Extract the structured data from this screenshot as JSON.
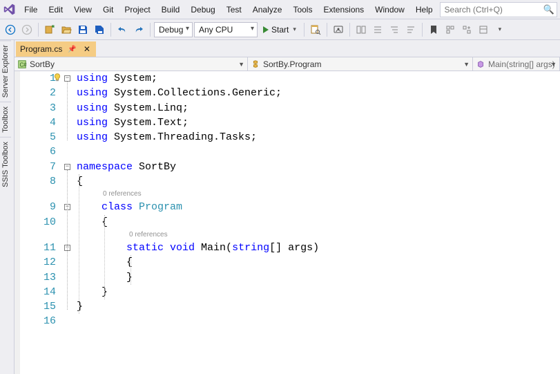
{
  "menu": [
    "File",
    "Edit",
    "View",
    "Git",
    "Project",
    "Build",
    "Debug",
    "Test",
    "Analyze",
    "Tools",
    "Extensions",
    "Window",
    "Help"
  ],
  "search": {
    "placeholder": "Search (Ctrl+Q)"
  },
  "toolbar": {
    "config": "Debug",
    "platform": "Any CPU",
    "start": "Start"
  },
  "sidetabs": [
    "Server Explorer",
    "Toolbox",
    "SSIS Toolbox"
  ],
  "doctab": {
    "title": "Program.cs"
  },
  "nav": {
    "project": "SortBy",
    "class": "SortBy.Program",
    "member": "Main(string[] args)"
  },
  "code": {
    "line_count": 16,
    "codelens": "0 references",
    "lines": [
      [
        {
          "t": "using ",
          "c": "kw"
        },
        {
          "t": "System;",
          "c": "plain"
        }
      ],
      [
        {
          "t": "using ",
          "c": "kw"
        },
        {
          "t": "System.Collections.Generic;",
          "c": "plain"
        }
      ],
      [
        {
          "t": "using ",
          "c": "kw"
        },
        {
          "t": "System.Linq;",
          "c": "plain"
        }
      ],
      [
        {
          "t": "using ",
          "c": "kw"
        },
        {
          "t": "System.Text;",
          "c": "plain"
        }
      ],
      [
        {
          "t": "using ",
          "c": "kw"
        },
        {
          "t": "System.Threading.Tasks;",
          "c": "plain"
        }
      ],
      [
        {
          "t": "",
          "c": "plain"
        }
      ],
      [
        {
          "t": "namespace ",
          "c": "kw"
        },
        {
          "t": "SortBy",
          "c": "plain"
        }
      ],
      [
        {
          "t": "{",
          "c": "plain"
        }
      ],
      [
        {
          "t": "    ",
          "c": "plain"
        },
        {
          "t": "class ",
          "c": "kw"
        },
        {
          "t": "Program",
          "c": "type"
        }
      ],
      [
        {
          "t": "    {",
          "c": "plain"
        }
      ],
      [
        {
          "t": "        ",
          "c": "plain"
        },
        {
          "t": "static ",
          "c": "kw"
        },
        {
          "t": "void ",
          "c": "kw"
        },
        {
          "t": "Main(",
          "c": "plain"
        },
        {
          "t": "string",
          "c": "kw"
        },
        {
          "t": "[] args)",
          "c": "plain"
        }
      ],
      [
        {
          "t": "        {",
          "c": "plain"
        }
      ],
      [
        {
          "t": "        }",
          "c": "plain"
        }
      ],
      [
        {
          "t": "    }",
          "c": "plain"
        }
      ],
      [
        {
          "t": "}",
          "c": "plain"
        }
      ],
      [
        {
          "t": "",
          "c": "plain"
        }
      ]
    ]
  }
}
